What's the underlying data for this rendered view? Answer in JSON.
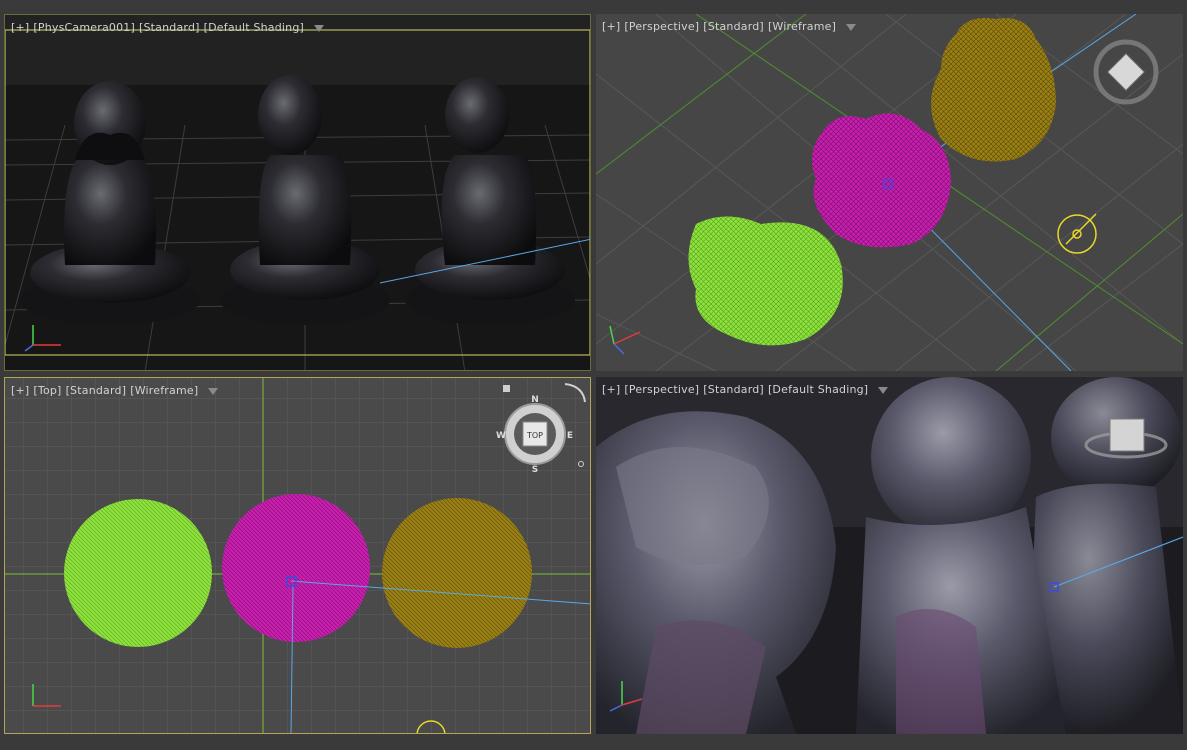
{
  "viewports": {
    "camera": {
      "plus": "[+]",
      "view": "[PhysCamera001]",
      "mode": "[Standard]",
      "shading": "[Default Shading]"
    },
    "persp_wire": {
      "plus": "[+]",
      "view": "[Perspective]",
      "mode": "[Standard]",
      "shading": "[Wireframe]"
    },
    "top": {
      "plus": "[+]",
      "view": "[Top]",
      "mode": "[Standard]",
      "shading": "[Wireframe]"
    },
    "persp_shaded": {
      "plus": "[+]",
      "view": "[Perspective]",
      "mode": "[Standard]",
      "shading": "[Default Shading]"
    }
  },
  "viewcube": {
    "top_face": "TOP",
    "compass": {
      "n": "N",
      "s": "S",
      "e": "E",
      "w": "W"
    }
  },
  "colors": {
    "green_object": "#8ee23c",
    "magenta_object": "#c81fb0",
    "olive_object": "#8a7212",
    "active_border": "#b6a35a",
    "camera_border": "#d8d86a"
  }
}
